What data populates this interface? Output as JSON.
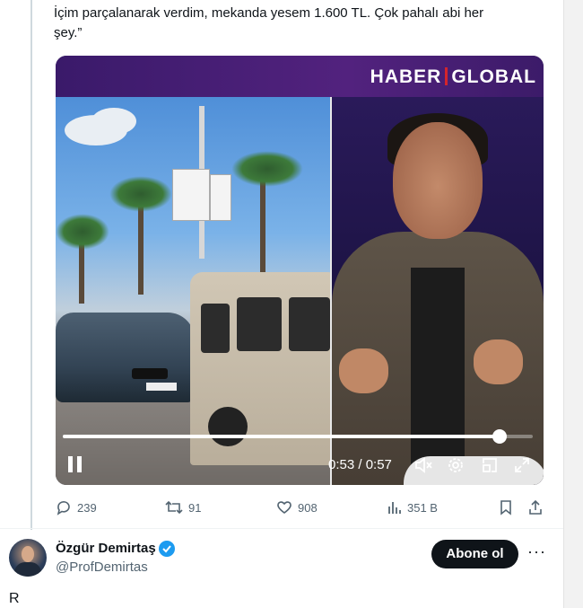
{
  "tweet": {
    "text_line1": "İçim parçalanarak verdim, mekanda yesem 1.600 TL. Çok pahalı abi her",
    "text_line2": "şey.”"
  },
  "video": {
    "brand_left": "HABER",
    "brand_right": "GLOBAL",
    "time_display": "0:53 / 0:57",
    "progress_fraction": 0.93,
    "icons": [
      "pause-icon",
      "volume-muted-icon",
      "settings-icon",
      "minimize-icon",
      "fullscreen-icon"
    ]
  },
  "metrics": {
    "replies": "239",
    "retweets": "91",
    "likes": "908",
    "views": "351 B"
  },
  "author": {
    "name": "Özgür Demirtaş",
    "handle": "@ProfDemirtas",
    "subscribe_label": "Abone ol",
    "more_label": "···"
  },
  "next_tweet": {
    "text": "R"
  },
  "colors": {
    "verified": "#1d9bf0",
    "muted_text": "#536471",
    "button_bg": "#0f1419"
  }
}
